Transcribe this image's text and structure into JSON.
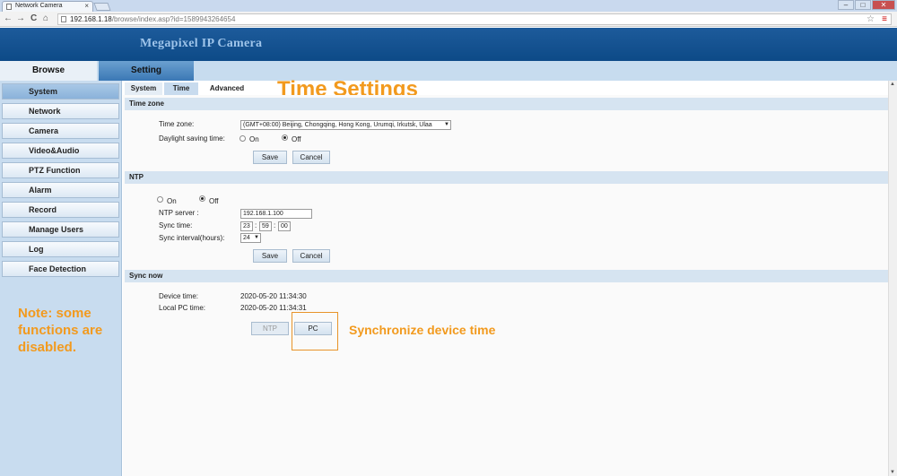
{
  "browser": {
    "tab_title": "Network Camera",
    "tab_close": "×",
    "back": "←",
    "forward": "→",
    "reload": "C",
    "home": "⌂",
    "url_host": "192.168.1.18",
    "url_path": "/browse/index.asp?id=1589943264654",
    "minimize": "–",
    "maximize": "□",
    "close": "✕",
    "star": "☆",
    "menu": "≡"
  },
  "banner": {
    "title": "Megapixel IP Camera"
  },
  "main_tabs": {
    "browse": "Browse",
    "setting": "Setting"
  },
  "sidebar": {
    "items": [
      {
        "label": "System"
      },
      {
        "label": "Network"
      },
      {
        "label": "Camera"
      },
      {
        "label": "Video&Audio"
      },
      {
        "label": "PTZ Function"
      },
      {
        "label": "Alarm"
      },
      {
        "label": "Record"
      },
      {
        "label": "Manage Users"
      },
      {
        "label": "Log"
      },
      {
        "label": "Face Detection"
      }
    ],
    "active_index": 0,
    "note": "Note: some functions are disabled."
  },
  "sub_tabs": {
    "system": "System",
    "time": "Time",
    "advanced": "Advanced"
  },
  "annotations": {
    "title": "Time Settings",
    "sync": "Synchronize device time"
  },
  "timezone_section": {
    "header": "Time zone",
    "timezone_label": "Time zone:",
    "timezone_value": "(GMT+08:00) Beijing, Chongqing, Hong Kong, Urumqi, Irkutsk, Ulaa",
    "dst_label": "Daylight saving time:",
    "dst_on": "On",
    "dst_off": "Off",
    "dst_selected": "Off",
    "save": "Save",
    "cancel": "Cancel"
  },
  "ntp_section": {
    "header": "NTP",
    "on": "On",
    "off": "Off",
    "selected": "Off",
    "server_label": "NTP server :",
    "server_value": "192.168.1.100",
    "sync_time_label": "Sync time:",
    "sync_hour": "23",
    "sync_minute": "59",
    "sync_second": "00",
    "interval_label": "Sync interval(hours):",
    "interval_value": "24",
    "save": "Save",
    "cancel": "Cancel"
  },
  "sync_section": {
    "header": "Sync now",
    "device_time_label": "Device time:",
    "device_time_value": "2020-05-20 11:34:30",
    "pc_time_label": "Local PC time:",
    "pc_time_value": "2020-05-20 11:34:31",
    "ntp_button": "NTP",
    "pc_button": "PC"
  },
  "colors": {
    "banner": "#0d4a87",
    "accent_orange": "#f29a1e",
    "sidebar_bg": "#c8dcef",
    "section_header": "#d6e4f1"
  }
}
